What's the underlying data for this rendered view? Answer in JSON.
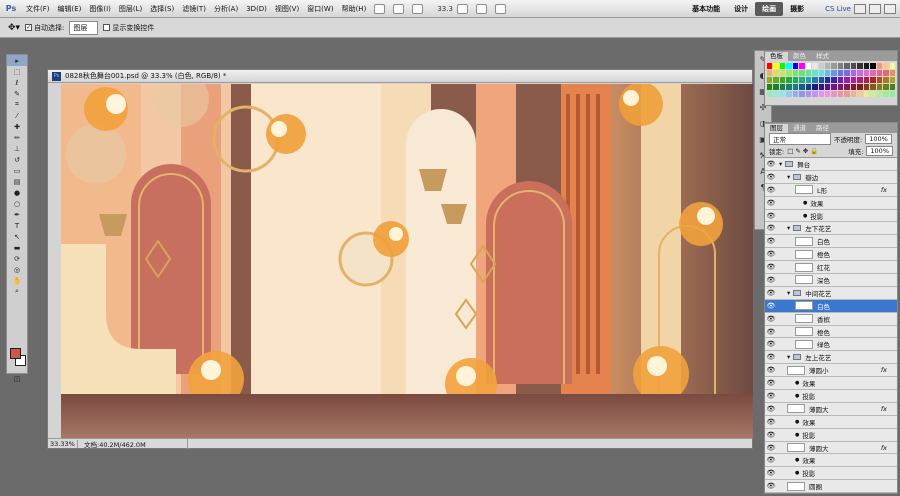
{
  "app": {
    "logo": "Ps",
    "menus": [
      "文件(F)",
      "编辑(E)",
      "图像(I)",
      "图层(L)",
      "选择(S)",
      "滤镜(T)",
      "分析(A)",
      "3D(D)",
      "视图(V)",
      "窗口(W)",
      "帮助(H)"
    ],
    "zoom": "33.3",
    "workspaces": [
      "基本功能",
      "设计",
      "绘画",
      "摄影"
    ],
    "active_workspace": "绘画",
    "cs_live": "CS Live"
  },
  "options": {
    "auto_select_label": "自动选择:",
    "auto_select_value": "图层",
    "show_transform_label": "显示变换控件"
  },
  "document": {
    "title": "0828秋色舞台001.psd @ 33.3% (白色, RGB/8) *",
    "status_zoom": "33.33%",
    "status_doc": "文档:40.2M/462.0M"
  },
  "swatches_panel": {
    "tabs": [
      "色板",
      "颜色",
      "样式"
    ],
    "active": "色板"
  },
  "layers_panel": {
    "tabs": [
      "图层",
      "通道",
      "路径"
    ],
    "active": "图层",
    "blend_mode": "正常",
    "opacity_label": "不透明度:",
    "opacity": "100%",
    "lock_label": "锁定:",
    "fill_label": "填充:",
    "fill": "100%",
    "rows": [
      {
        "name": "舞台",
        "type": "group",
        "indent": 0
      },
      {
        "name": "瓣边",
        "type": "group",
        "indent": 1
      },
      {
        "name": "L形",
        "type": "layer",
        "indent": 2,
        "fx": "fx"
      },
      {
        "name": "效果",
        "type": "effect",
        "indent": 3
      },
      {
        "name": "投影",
        "type": "effect",
        "indent": 3
      },
      {
        "name": "左下花艺",
        "type": "group",
        "indent": 1
      },
      {
        "name": "白色",
        "type": "layer",
        "indent": 2
      },
      {
        "name": "橙色",
        "type": "layer",
        "indent": 2
      },
      {
        "name": "红花",
        "type": "layer",
        "indent": 2
      },
      {
        "name": "深色",
        "type": "layer",
        "indent": 2
      },
      {
        "name": "中间花艺",
        "type": "group",
        "indent": 1
      },
      {
        "name": "白色",
        "type": "layer",
        "indent": 2,
        "selected": true
      },
      {
        "name": "香槟",
        "type": "layer",
        "indent": 2
      },
      {
        "name": "橙色",
        "type": "layer",
        "indent": 2
      },
      {
        "name": "绿色",
        "type": "layer",
        "indent": 2
      },
      {
        "name": "左上花艺",
        "type": "group",
        "indent": 1
      },
      {
        "name": "薄圆小",
        "type": "layer",
        "indent": 1,
        "fx": "fx"
      },
      {
        "name": "效果",
        "type": "effect",
        "indent": 2
      },
      {
        "name": "投影",
        "type": "effect",
        "indent": 2
      },
      {
        "name": "薄圆大",
        "type": "layer",
        "indent": 1,
        "fx": "fx"
      },
      {
        "name": "效果",
        "type": "effect",
        "indent": 2
      },
      {
        "name": "投影",
        "type": "effect",
        "indent": 2
      },
      {
        "name": "薄圆大",
        "type": "layer",
        "indent": 1,
        "fx": "fx"
      },
      {
        "name": "效果",
        "type": "effect",
        "indent": 2
      },
      {
        "name": "投影",
        "type": "effect",
        "indent": 2
      },
      {
        "name": "圆圈",
        "type": "layer",
        "indent": 1
      }
    ]
  },
  "colors": {
    "accent": "#3a78cf",
    "foreground": "#c9574d",
    "background": "#ffffff",
    "brand": "#1e3d7a"
  }
}
